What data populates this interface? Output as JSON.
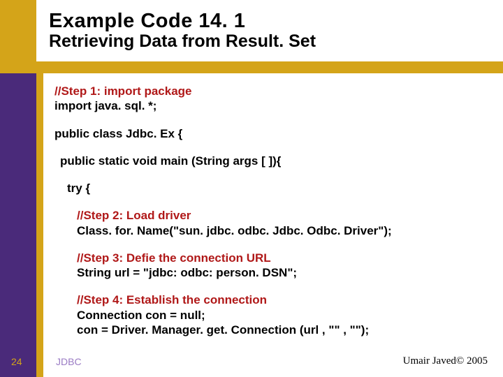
{
  "title": {
    "line1": "Example Code 14. 1",
    "line2": "Retrieving Data from Result. Set"
  },
  "code": {
    "step1_comment": "//Step 1: import package",
    "step1_line": " import java. sql. *;",
    "class_decl": "public class Jdbc. Ex {",
    "main_decl": "public static void main (String args [ ]){",
    "try_line": "try {",
    "step2_comment": "//Step 2: Load driver",
    "step2_line": "Class. for. Name(\"sun. jdbc. odbc. Jdbc. Odbc. Driver\");",
    "step3_comment": "//Step 3: Defie the connection URL",
    "step3_line": "String url = \"jdbc: odbc: person. DSN\";",
    "step4_comment": "//Step 4: Establish the connection",
    "step4_line1": "Connection con = null;",
    "step4_line2": "con = Driver. Manager. get. Connection (url , \"\" , \"\");"
  },
  "footer": {
    "page_num": "24",
    "label": "JDBC",
    "copyright": "Umair Javed© 2005"
  }
}
